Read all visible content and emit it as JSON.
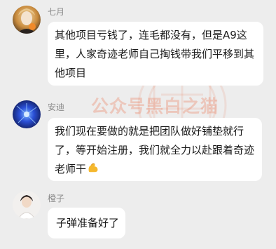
{
  "watermark": {
    "text": "公众号黑白之猫"
  },
  "messages": [
    {
      "sender": "七月",
      "avatar_icon": "avatar-qiyue-icon",
      "lines": [
        "其他项目亏钱了，连毛都没有，但是A9这",
        "里，人家奇迹老师自己掏钱带我们平移到其",
        "他项目"
      ]
    },
    {
      "sender": "安迪",
      "avatar_icon": "avatar-andi-icon",
      "lines": [
        "我们现在要做的就是把团队做好铺垫就行",
        "了，等开始注册，我们就全力以赴跟着奇迹",
        "老师干"
      ],
      "emoji_icon": "flexed-biceps-icon",
      "emoji_char": "💪"
    },
    {
      "sender": "橙子",
      "avatar_icon": "avatar-chengzi-icon",
      "lines": [
        "子弹准备好了"
      ]
    }
  ],
  "colors": {
    "background": "#ededed",
    "bubble": "#ffffff",
    "sender_name": "#8a8a8a",
    "text": "#1a1a1a",
    "watermark": "#e87654"
  }
}
